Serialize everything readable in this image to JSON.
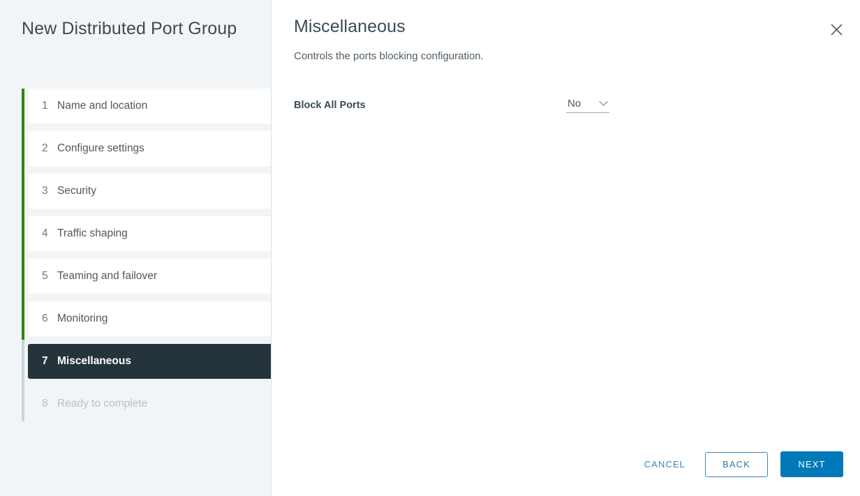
{
  "sidebar": {
    "title": "New Distributed Port Group",
    "steps": [
      {
        "num": "1",
        "label": "Name and location",
        "state": "done"
      },
      {
        "num": "2",
        "label": "Configure settings",
        "state": "done"
      },
      {
        "num": "3",
        "label": "Security",
        "state": "done"
      },
      {
        "num": "4",
        "label": "Traffic shaping",
        "state": "done"
      },
      {
        "num": "5",
        "label": "Teaming and failover",
        "state": "done"
      },
      {
        "num": "6",
        "label": "Monitoring",
        "state": "done"
      },
      {
        "num": "7",
        "label": "Miscellaneous",
        "state": "active"
      },
      {
        "num": "8",
        "label": "Ready to complete",
        "state": "disabled"
      }
    ]
  },
  "content": {
    "title": "Miscellaneous",
    "subtitle": "Controls the ports blocking configuration.",
    "close_icon": "close-icon",
    "form": {
      "block_all_ports": {
        "label": "Block All Ports",
        "value": "No",
        "chevron_icon": "chevron-down-icon"
      }
    }
  },
  "footer": {
    "cancel_label": "CANCEL",
    "back_label": "BACK",
    "next_label": "NEXT"
  },
  "colors": {
    "accent_blue": "#0079b8",
    "progress_green": "#318700",
    "active_step_bg": "#25333b",
    "sidebar_bg": "#f2f5f7"
  }
}
